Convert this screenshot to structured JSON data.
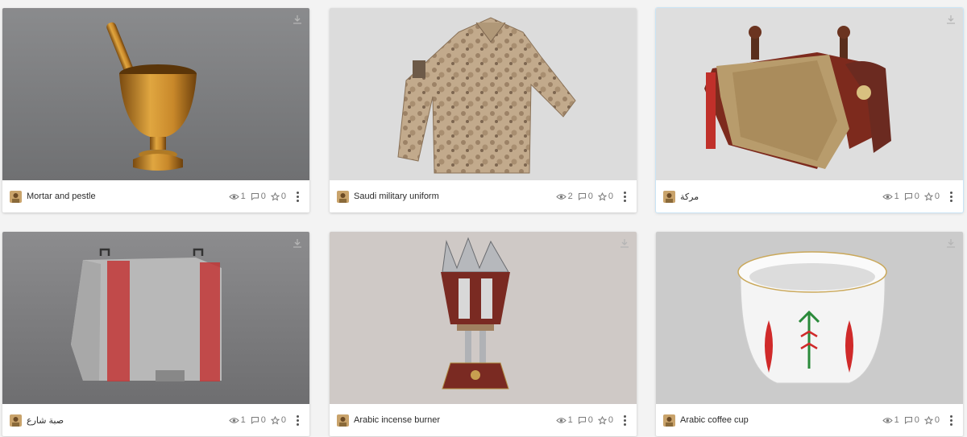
{
  "colors": {
    "accent_border": "#c9e4f5",
    "title_text": "#2b2b2b",
    "stat_text": "#7a7a7a"
  },
  "icons": {
    "download": "download-icon",
    "views": "eye-icon",
    "comments": "comment-icon",
    "likes": "star-icon",
    "menu": "more-vertical-icon"
  },
  "models": [
    {
      "title": "Mortar and pestle",
      "views": "1",
      "comments": "0",
      "likes": "0"
    },
    {
      "title": "Saudi military uniform",
      "views": "2",
      "comments": "0",
      "likes": "0"
    },
    {
      "title": "مركة",
      "views": "1",
      "comments": "0",
      "likes": "0"
    },
    {
      "title": "صبة شارع",
      "views": "1",
      "comments": "0",
      "likes": "0"
    },
    {
      "title": "Arabic incense burner",
      "views": "1",
      "comments": "0",
      "likes": "0"
    },
    {
      "title": "Arabic coffee cup",
      "views": "1",
      "comments": "0",
      "likes": "0"
    }
  ]
}
